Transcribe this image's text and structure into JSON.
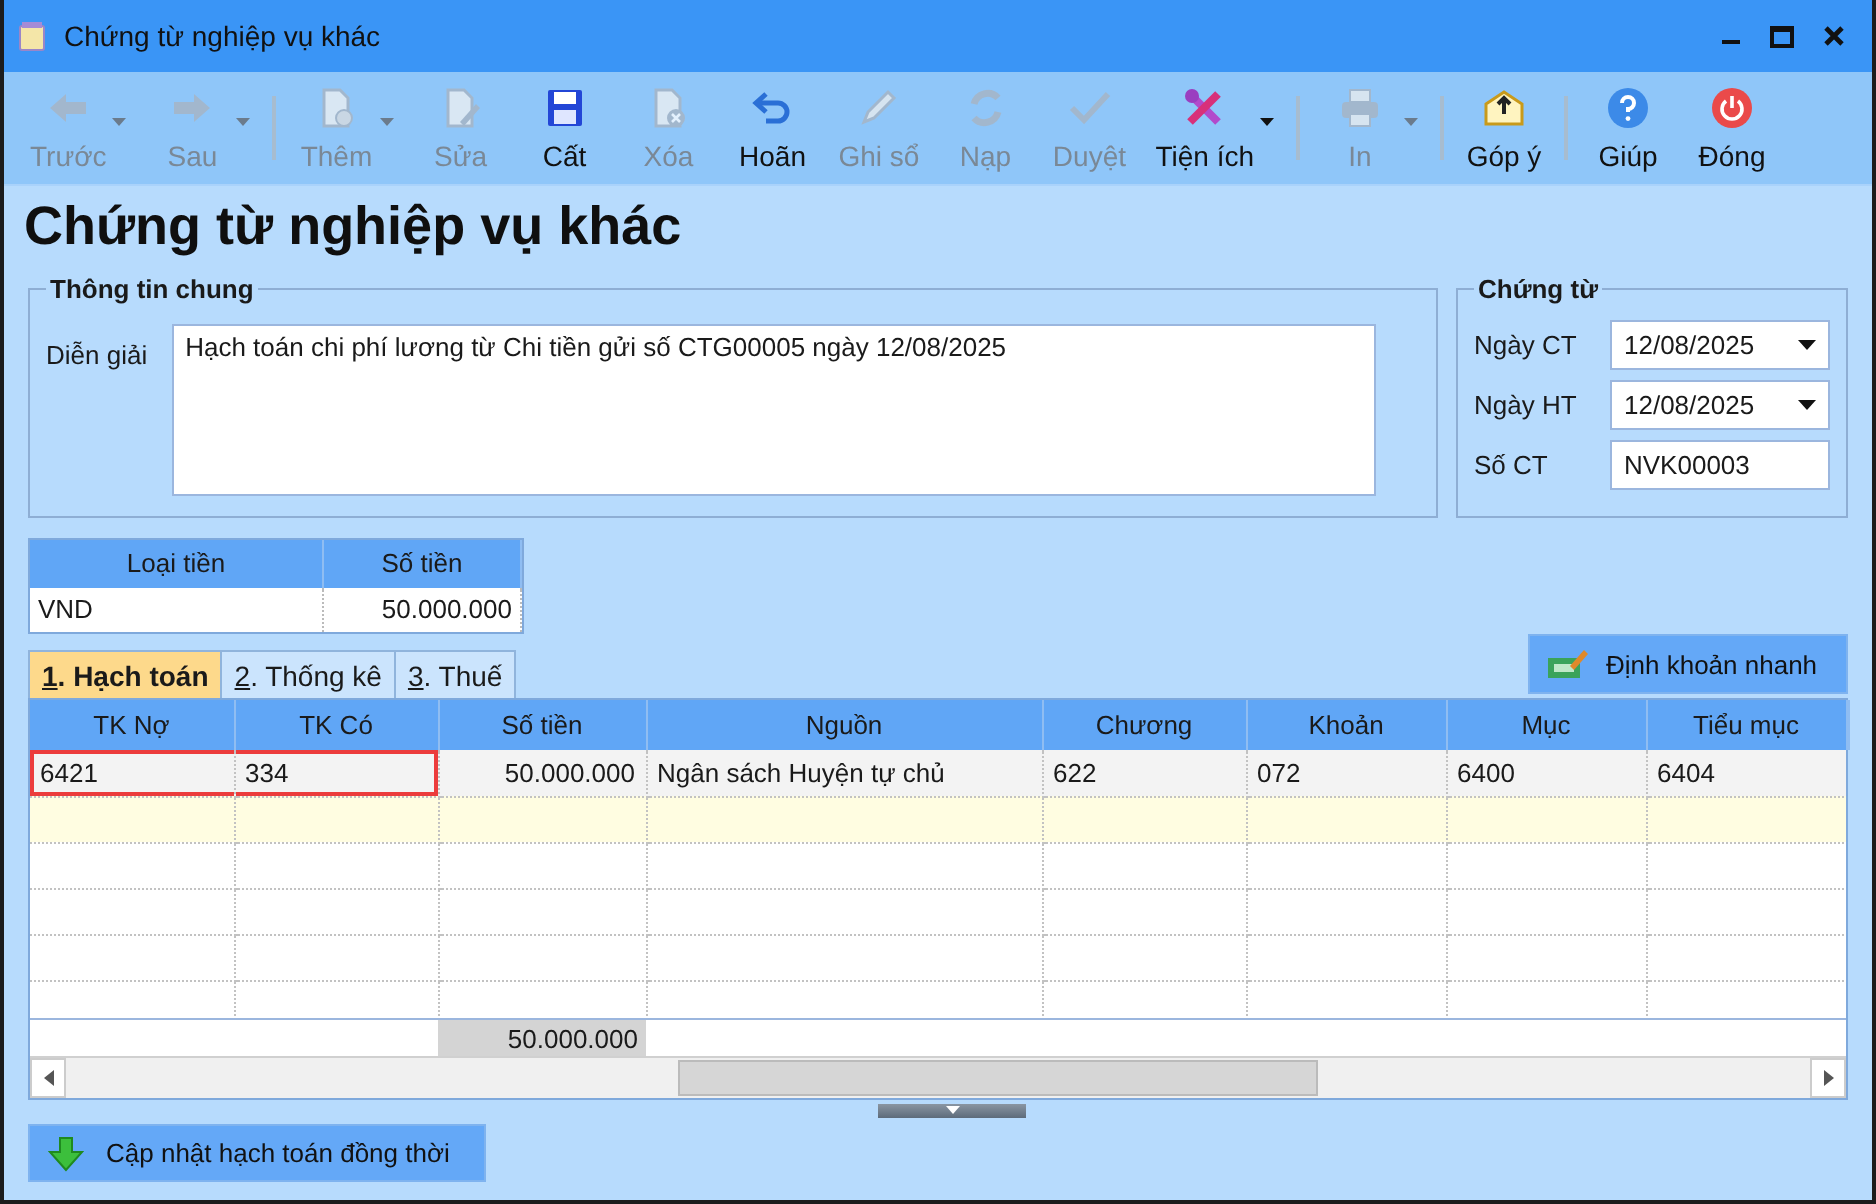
{
  "window": {
    "title": "Chứng từ nghiệp vụ khác"
  },
  "toolbar": [
    {
      "kind": "button",
      "label": "Trước",
      "disabled": true,
      "dropdown": true
    },
    {
      "kind": "button",
      "label": "Sau",
      "disabled": true,
      "dropdown": true
    },
    {
      "kind": "separator"
    },
    {
      "kind": "button",
      "label": "Thêm",
      "disabled": true,
      "dropdown": true
    },
    {
      "kind": "button",
      "label": "Sửa",
      "disabled": true,
      "dropdown": false
    },
    {
      "kind": "button",
      "label": "Cất",
      "disabled": false,
      "dropdown": false
    },
    {
      "kind": "button",
      "label": "Xóa",
      "disabled": true,
      "dropdown": false
    },
    {
      "kind": "button",
      "label": "Hoãn",
      "disabled": false,
      "dropdown": false
    },
    {
      "kind": "button",
      "label": "Ghi sổ",
      "disabled": true,
      "dropdown": false
    },
    {
      "kind": "button",
      "label": "Nạp",
      "disabled": true,
      "dropdown": false
    },
    {
      "kind": "button",
      "label": "Duyệt",
      "disabled": true,
      "dropdown": false
    },
    {
      "kind": "button",
      "label": "Tiện ích",
      "disabled": false,
      "dropdown": true
    },
    {
      "kind": "separator"
    },
    {
      "kind": "button",
      "label": "In",
      "disabled": true,
      "dropdown": true
    },
    {
      "kind": "separator"
    },
    {
      "kind": "button",
      "label": "Góp ý",
      "disabled": false,
      "dropdown": false
    },
    {
      "kind": "separator"
    },
    {
      "kind": "button",
      "label": "Giúp",
      "disabled": false,
      "dropdown": false
    },
    {
      "kind": "button",
      "label": "Đóng",
      "disabled": false,
      "dropdown": false
    }
  ],
  "heading": "Chứng từ nghiệp vụ khác",
  "general_info": {
    "title": "Thông tin chung",
    "description_label": "Diễn giải",
    "description": "Hạch toán chi phí lương từ Chi tiền gửi số CTG00005 ngày 12/08/2025"
  },
  "voucher": {
    "title": "Chứng từ",
    "fields": [
      {
        "kind": "date",
        "label": "Ngày CT",
        "value": "12/08/2025"
      },
      {
        "kind": "date",
        "label": "Ngày HT",
        "value": "12/08/2025"
      },
      {
        "kind": "text",
        "label": "Số CT",
        "value": "NVK00003"
      }
    ]
  },
  "currency_table": {
    "columns": [
      "Loại tiền",
      "Số tiền"
    ],
    "rows": [
      [
        "VND",
        "50.000.000"
      ]
    ]
  },
  "tabs": [
    {
      "label": "1. Hạch toán",
      "selected": true
    },
    {
      "label": "2. Thống kê",
      "selected": false
    },
    {
      "label": "3. Thuế",
      "selected": false
    }
  ],
  "quick_entry_button": "Định khoản nhanh",
  "entries_table": {
    "columns": [
      {
        "label": "TK Nợ",
        "kind": "text"
      },
      {
        "label": "TK Có",
        "kind": "text"
      },
      {
        "label": "Số tiền",
        "kind": "amount"
      },
      {
        "label": "Nguồn",
        "kind": "text"
      },
      {
        "label": "Chương",
        "kind": "text"
      },
      {
        "label": "Khoản",
        "kind": "text"
      },
      {
        "label": "Mục",
        "kind": "text"
      },
      {
        "label": "Tiểu mục",
        "kind": "text"
      }
    ],
    "rows": [
      {
        "kind": "data",
        "cells": [
          {
            "text": "6421",
            "highlighted": true
          },
          {
            "text": "334",
            "highlighted": true
          },
          {
            "text": "50.000.000",
            "highlighted": false
          },
          {
            "text": "Ngân sách Huyện tự chủ",
            "highlighted": false
          },
          {
            "text": "622",
            "highlighted": false
          },
          {
            "text": "072",
            "highlighted": false
          },
          {
            "text": "6400",
            "highlighted": false
          },
          {
            "text": "6404",
            "highlighted": false
          }
        ]
      },
      {
        "kind": "new"
      },
      {
        "kind": "empty"
      },
      {
        "kind": "empty"
      },
      {
        "kind": "empty"
      },
      {
        "kind": "empty"
      }
    ],
    "total": "50.000.000"
  },
  "update_button": "Cập nhật hạch toán đồng thời"
}
